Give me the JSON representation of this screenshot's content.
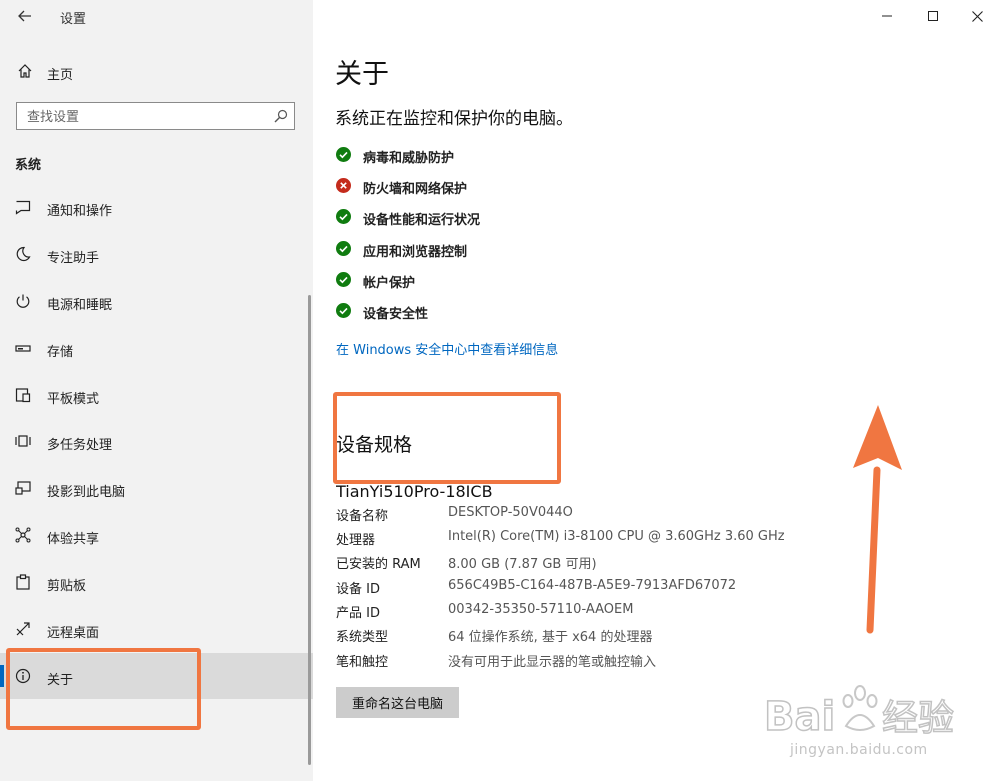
{
  "window": {
    "title": "设置"
  },
  "sidebar": {
    "home_label": "主页",
    "search_placeholder": "查找设置",
    "section_header": "系统",
    "items": [
      {
        "label": "通知和操作",
        "icon": "notification-icon"
      },
      {
        "label": "专注助手",
        "icon": "moon-icon"
      },
      {
        "label": "电源和睡眠",
        "icon": "power-icon"
      },
      {
        "label": "存储",
        "icon": "storage-icon"
      },
      {
        "label": "平板模式",
        "icon": "tablet-icon"
      },
      {
        "label": "多任务处理",
        "icon": "multitasking-icon"
      },
      {
        "label": "投影到此电脑",
        "icon": "projecting-icon"
      },
      {
        "label": "体验共享",
        "icon": "shared-experiences-icon"
      },
      {
        "label": "剪贴板",
        "icon": "clipboard-icon"
      },
      {
        "label": "远程桌面",
        "icon": "remote-desktop-icon"
      },
      {
        "label": "关于",
        "icon": "info-icon",
        "active": true
      }
    ]
  },
  "main": {
    "title": "关于",
    "subtitle": "系统正在监控和保护你的电脑。",
    "status_items": [
      {
        "label": "病毒和威胁防护",
        "status": "ok"
      },
      {
        "label": "防火墙和网络保护",
        "status": "error"
      },
      {
        "label": "设备性能和运行状况",
        "status": "ok"
      },
      {
        "label": "应用和浏览器控制",
        "status": "ok"
      },
      {
        "label": "帐户保护",
        "status": "ok"
      },
      {
        "label": "设备安全性",
        "status": "ok"
      }
    ],
    "security_link": "在 Windows 安全中心中查看详细信息",
    "spec_title": "设备规格",
    "device_model": "TianYi510Pro-18ICB",
    "specs": [
      {
        "key": "设备名称",
        "value": "DESKTOP-50V044O"
      },
      {
        "key": "处理器",
        "value": "Intel(R) Core(TM) i3-8100 CPU @ 3.60GHz   3.60 GHz"
      },
      {
        "key": "已安装的 RAM",
        "value": "8.00 GB (7.87 GB 可用)"
      },
      {
        "key": "设备 ID",
        "value": "656C49B5-C164-487B-A5E9-7913AFD67072"
      },
      {
        "key": "产品 ID",
        "value": "00342-35350-57110-AAOEM"
      },
      {
        "key": "系统类型",
        "value": "64 位操作系统, 基于 x64 的处理器"
      },
      {
        "key": "笔和触控",
        "value": "没有可用于此显示器的笔或触控输入"
      }
    ],
    "rename_button": "重命名这台电脑"
  },
  "watermark": {
    "brand": "Bai",
    "brand_cn": "经验",
    "url": "jingyan.baidu.com"
  },
  "colors": {
    "accent": "#0067c0",
    "ok": "#107c10",
    "error": "#c42b1c",
    "annotation": "#f07641",
    "sidebar_bg": "#f2f2f2"
  }
}
